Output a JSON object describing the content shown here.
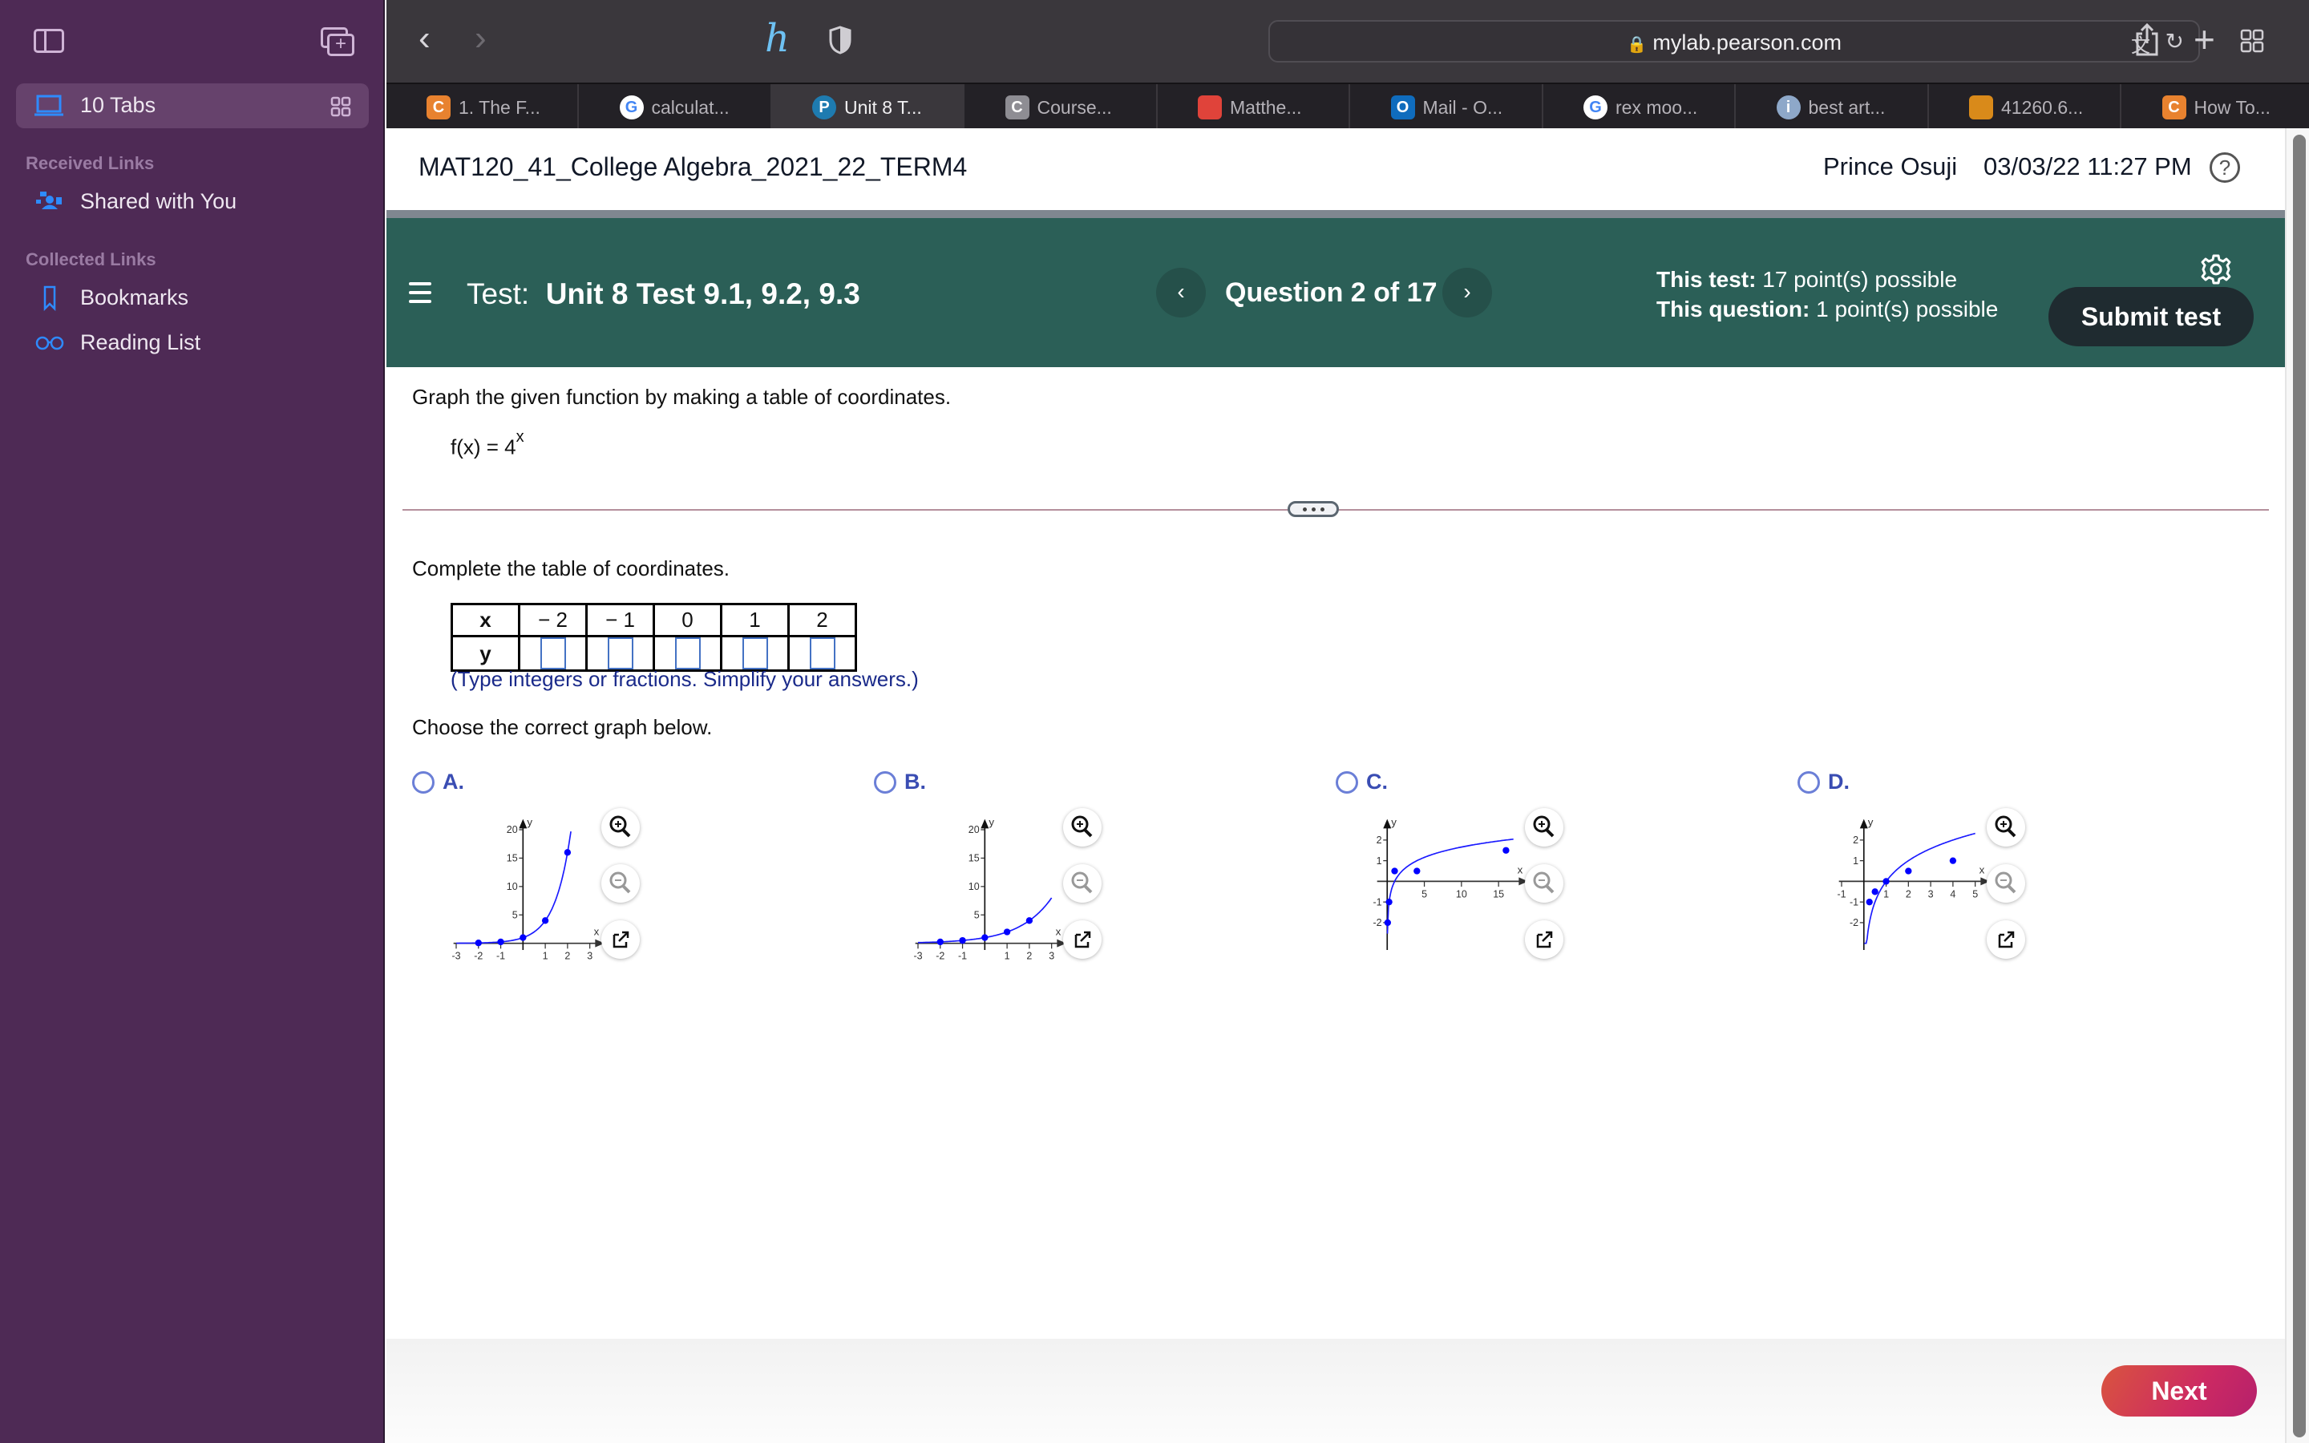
{
  "sidebar": {
    "tabs_label": "10 Tabs",
    "sections": [
      {
        "title": "Received Links",
        "items": [
          {
            "label": "Shared with You",
            "icon": "shared-with-you-icon"
          }
        ]
      },
      {
        "title": "Collected Links",
        "items": [
          {
            "label": "Bookmarks",
            "icon": "bookmark-icon"
          },
          {
            "label": "Reading List",
            "icon": "reading-list-icon"
          }
        ]
      }
    ]
  },
  "browser": {
    "url": "mylab.pearson.com",
    "tabs": [
      {
        "label": "1. The F...",
        "favicon": "C",
        "favicon_color": "#e8822f",
        "active": false
      },
      {
        "label": "calculat...",
        "favicon": "G",
        "favicon_color": "#ffffff",
        "active": false
      },
      {
        "label": "Unit 8 T...",
        "favicon": "P",
        "favicon_color": "#1e7bb0",
        "active": true
      },
      {
        "label": "Course...",
        "favicon": "C",
        "favicon_color": "#8e8d93",
        "active": false
      },
      {
        "label": "Matthe...",
        "favicon": "",
        "favicon_color": "#e0433a",
        "active": false
      },
      {
        "label": "Mail - O...",
        "favicon": "O",
        "favicon_color": "#0f6cbd",
        "active": false
      },
      {
        "label": "rex moo...",
        "favicon": "G",
        "favicon_color": "#ffffff",
        "active": false
      },
      {
        "label": "best art...",
        "favicon": "i",
        "favicon_color": "#8ea8c9",
        "active": false
      },
      {
        "label": "41260.6...",
        "favicon": "",
        "favicon_color": "#d98a1a",
        "active": false
      },
      {
        "label": "How To...",
        "favicon": "C",
        "favicon_color": "#e8822f",
        "active": false
      }
    ]
  },
  "header": {
    "course_title": "MAT120_41_College Algebra_2021_22_TERM4",
    "user_name": "Prince Osuji",
    "datetime": "03/03/22 11:27 PM"
  },
  "testbar": {
    "test_prefix": "Test:",
    "test_name": "Unit 8 Test 9.1, 9.2, 9.3",
    "question_counter": "Question 2 of 17",
    "this_test_label": "This test:",
    "this_test_value": "17 point(s) possible",
    "this_question_label": "This question:",
    "this_question_value": "1 point(s) possible",
    "submit_label": "Submit test"
  },
  "question": {
    "prompt": "Graph the given function by making a table of coordinates.",
    "function_base": "f(x) = 4",
    "function_exponent": "x",
    "table_prompt": "Complete the table of coordinates.",
    "table": {
      "x_header": "x",
      "y_header": "y",
      "x_values": [
        "− 2",
        "− 1",
        "0",
        "1",
        "2"
      ],
      "y_values": [
        "",
        "",
        "",
        "",
        ""
      ]
    },
    "hint": "(Type integers or fractions. Simplify your answers.)",
    "choose_prompt": "Choose the correct graph below.",
    "options": [
      {
        "label": "A.",
        "selected": false
      },
      {
        "label": "B.",
        "selected": false
      },
      {
        "label": "C.",
        "selected": false
      },
      {
        "label": "D.",
        "selected": false
      }
    ]
  },
  "footer": {
    "next_label": "Next"
  },
  "chart_data": [
    {
      "type": "line",
      "option": "A",
      "function": "4^x",
      "xlabel": "x",
      "ylabel": "y",
      "xlim": [
        -3,
        3
      ],
      "ylim": [
        0,
        20
      ],
      "xticks": [
        -3,
        -2,
        -1,
        1,
        2,
        3
      ],
      "yticks": [
        5,
        10,
        15,
        20
      ],
      "points": [
        [
          -2,
          0.0625
        ],
        [
          -1,
          0.25
        ],
        [
          0,
          1
        ],
        [
          1,
          4
        ],
        [
          2,
          16
        ]
      ],
      "curve_x_range": [
        -3,
        2.15
      ]
    },
    {
      "type": "line",
      "option": "B",
      "function": "2^x",
      "xlabel": "x",
      "ylabel": "y",
      "xlim": [
        -3,
        3
      ],
      "ylim": [
        0,
        20
      ],
      "xticks": [
        -3,
        -2,
        -1,
        1,
        2,
        3
      ],
      "yticks": [
        5,
        10,
        15,
        20
      ],
      "points": [
        [
          -2,
          0.25
        ],
        [
          -1,
          0.5
        ],
        [
          0,
          1
        ],
        [
          1,
          2
        ],
        [
          2,
          4
        ]
      ],
      "curve_x_range": [
        -3,
        3
      ]
    },
    {
      "type": "line",
      "option": "C",
      "function": "log_4(x)",
      "xlabel": "x",
      "ylabel": "y",
      "xlim": [
        -1,
        17
      ],
      "ylim": [
        -3,
        2.5
      ],
      "xticks": [
        5,
        10,
        15
      ],
      "yticks": [
        -2,
        -1,
        1,
        2
      ],
      "points": [
        [
          0.0625,
          -2
        ],
        [
          0.25,
          -1
        ],
        [
          1,
          0.5
        ],
        [
          4,
          0.5
        ],
        [
          16,
          1.5
        ]
      ],
      "curve_x_range": [
        0.03,
        17
      ]
    },
    {
      "type": "line",
      "option": "D",
      "function": "log_2(x)",
      "xlabel": "x",
      "ylabel": "y",
      "xlim": [
        -1,
        5
      ],
      "ylim": [
        -3,
        2.5
      ],
      "xticks": [
        -1,
        1,
        2,
        3,
        4,
        5
      ],
      "yticks": [
        -2,
        -1,
        1,
        2
      ],
      "points": [
        [
          0.25,
          -1
        ],
        [
          0.5,
          -0.5
        ],
        [
          1,
          0
        ],
        [
          2,
          0.5
        ],
        [
          4,
          1
        ]
      ],
      "curve_x_range": [
        0.02,
        5
      ]
    }
  ]
}
